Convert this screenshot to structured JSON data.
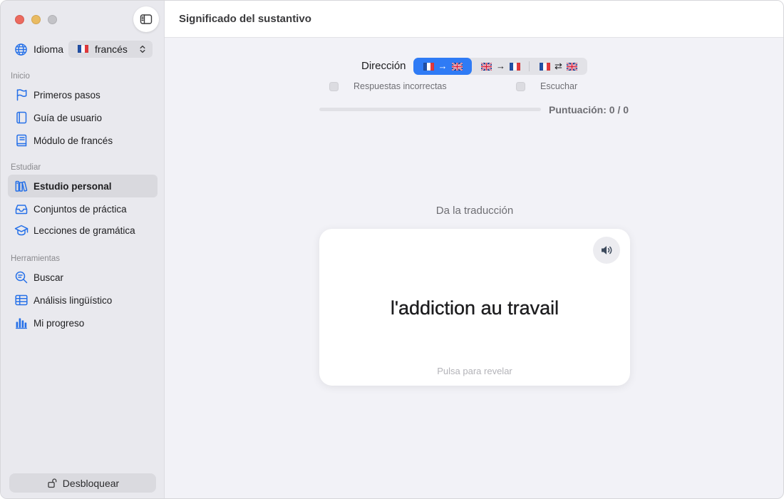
{
  "window": {
    "title": "Significado del sustantivo",
    "controls": [
      "close",
      "minimize",
      "zoom"
    ]
  },
  "sidebar": {
    "toggle_icon": "sidebar-left-icon",
    "language": {
      "label": "Idioma",
      "icon": "globe-icon",
      "selected": "francés",
      "selected_flag": "flag-fr-icon"
    },
    "sections": [
      {
        "title": "Inicio",
        "items": [
          {
            "label": "Primeros pasos",
            "icon": "flag-icon"
          },
          {
            "label": "Guía de usuario",
            "icon": "book-icon"
          },
          {
            "label": "Módulo de francés",
            "icon": "text-book-icon"
          }
        ]
      },
      {
        "title": "Estudiar",
        "items": [
          {
            "label": "Estudio personal",
            "icon": "books-icon",
            "selected": true
          },
          {
            "label": "Conjuntos de práctica",
            "icon": "tray-icon"
          },
          {
            "label": "Lecciones de gramática",
            "icon": "graduation-cap-icon"
          }
        ]
      },
      {
        "title": "Herramientas",
        "items": [
          {
            "label": "Buscar",
            "icon": "search-icon"
          },
          {
            "label": "Análisis lingüístico",
            "icon": "table-icon"
          },
          {
            "label": "Mi progreso",
            "icon": "bar-chart-icon"
          }
        ]
      }
    ],
    "unlock_button": {
      "label": "Desbloquear",
      "icon": "lock-open-icon"
    }
  },
  "direction": {
    "label": "Dirección",
    "segments": [
      {
        "from_flag": "flag-fr-icon",
        "arrow": "→",
        "to_flag": "flag-gb-icon",
        "selected": true
      },
      {
        "from_flag": "flag-gb-icon",
        "arrow": "→",
        "to_flag": "flag-fr-icon",
        "selected": false
      },
      {
        "from_flag": "flag-fr-icon",
        "arrow": "⇄",
        "to_flag": "flag-gb-icon",
        "selected": false
      }
    ]
  },
  "options": [
    {
      "label": "Respuestas incorrectas",
      "checked": false
    },
    {
      "label": "Escuchar",
      "checked": false
    }
  ],
  "progress": {
    "value": 0,
    "score_text": "Puntuación: 0 / 0"
  },
  "prompt": "Da la traducción",
  "card": {
    "word": "l'addiction au travail",
    "hint": "Pulsa para revelar",
    "speaker_icon": "speaker-icon"
  },
  "colors": {
    "accent": "#2f7bf5",
    "sidebar_icon": "#2570e8",
    "sidebar_background": "#e9e9ee",
    "content_background": "#f2f2f7",
    "secondary_text": "#6e6e73"
  }
}
